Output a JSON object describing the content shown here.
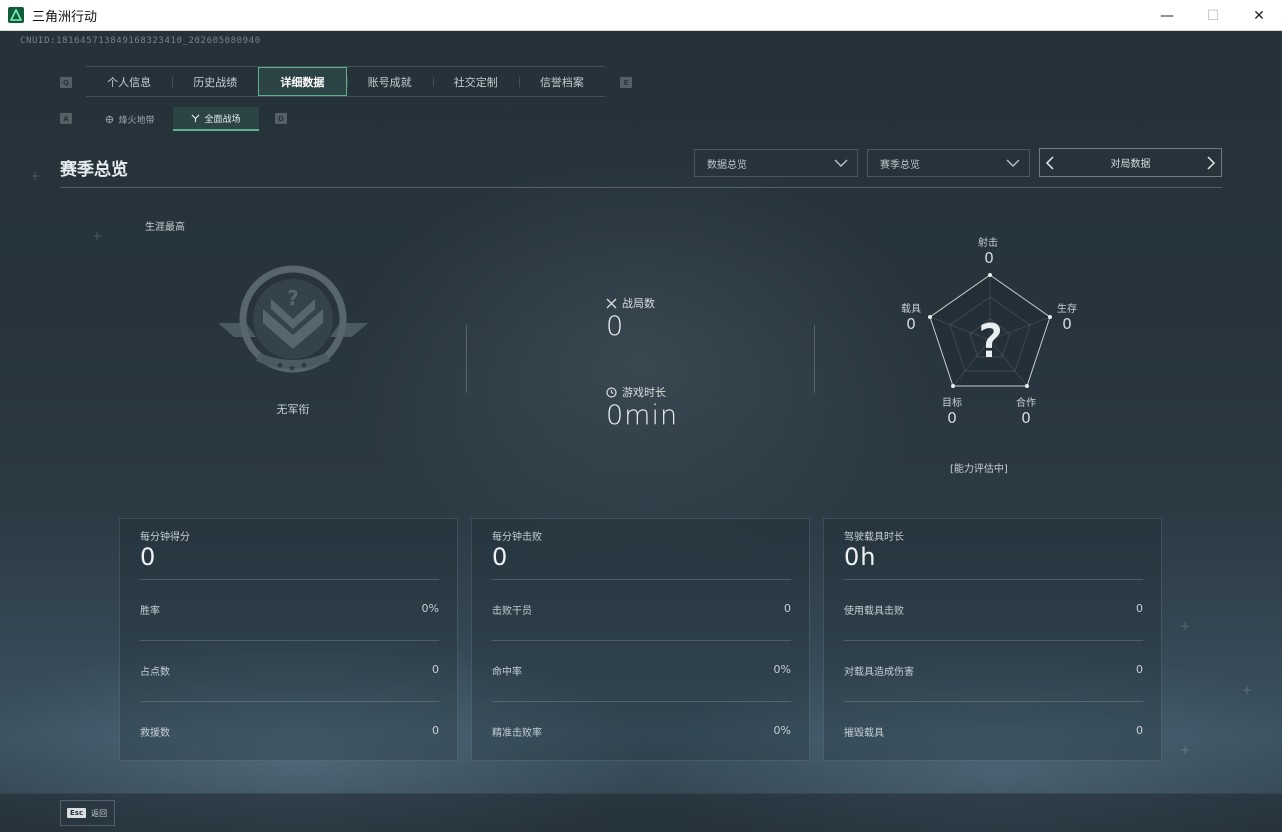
{
  "window": {
    "title": "三角洲行动",
    "controls": {
      "minimize": "—",
      "maximize": "☐",
      "close": "✕"
    }
  },
  "uid": "CNUID:181645713849168323410_202605080940",
  "tabs": {
    "prev_key": "Q",
    "next_key": "E",
    "items": [
      {
        "label": "个人信息",
        "active": false
      },
      {
        "label": "历史战绩",
        "active": false
      },
      {
        "label": "详细数据",
        "active": true
      },
      {
        "label": "账号成就",
        "active": false
      },
      {
        "label": "社交定制",
        "active": false
      },
      {
        "label": "信誉档案",
        "active": false
      }
    ]
  },
  "subtabs": {
    "prev_key": "A",
    "next_key": "D",
    "items": [
      {
        "label": "烽火地带",
        "icon": "extraction-icon",
        "active": false
      },
      {
        "label": "全面战场",
        "icon": "battlefield-icon",
        "active": true
      }
    ]
  },
  "header": {
    "title": "赛季总览",
    "dropdown1": "数据总览",
    "dropdown2": "赛季总览",
    "pager_label": "对局数据"
  },
  "rank": {
    "career_label": "生涯最高",
    "rank_name": "无军衔"
  },
  "stats": {
    "matches_label": "战局数",
    "matches_value": "0",
    "playtime_label": "游戏时长",
    "playtime_value": "0min"
  },
  "radar": {
    "axes": [
      {
        "label": "射击",
        "value": "0"
      },
      {
        "label": "生存",
        "value": "0"
      },
      {
        "label": "合作",
        "value": "0"
      },
      {
        "label": "目标",
        "value": "0"
      },
      {
        "label": "载具",
        "value": "0"
      }
    ],
    "center_glyph": "?",
    "note": "[能力评估中]"
  },
  "panels": [
    {
      "title": "每分钟得分",
      "value": "0",
      "rows": [
        {
          "label": "胜率",
          "value": "0%"
        },
        {
          "label": "占点数",
          "value": "0"
        },
        {
          "label": "救援数",
          "value": "0"
        }
      ]
    },
    {
      "title": "每分钟击败",
      "value": "0",
      "rows": [
        {
          "label": "击败干员",
          "value": "0"
        },
        {
          "label": "命中率",
          "value": "0%"
        },
        {
          "label": "精准击败率",
          "value": "0%"
        }
      ]
    },
    {
      "title": "驾驶载具时长",
      "value": "0h",
      "rows": [
        {
          "label": "使用载具击败",
          "value": "0"
        },
        {
          "label": "对载具造成伤害",
          "value": "0"
        },
        {
          "label": "摧毁载具",
          "value": "0"
        }
      ]
    }
  ],
  "bottom": {
    "esc_key": "Esc",
    "esc_label": "返回"
  },
  "colors": {
    "accent": "#5fb08e",
    "background": "#27343c"
  }
}
